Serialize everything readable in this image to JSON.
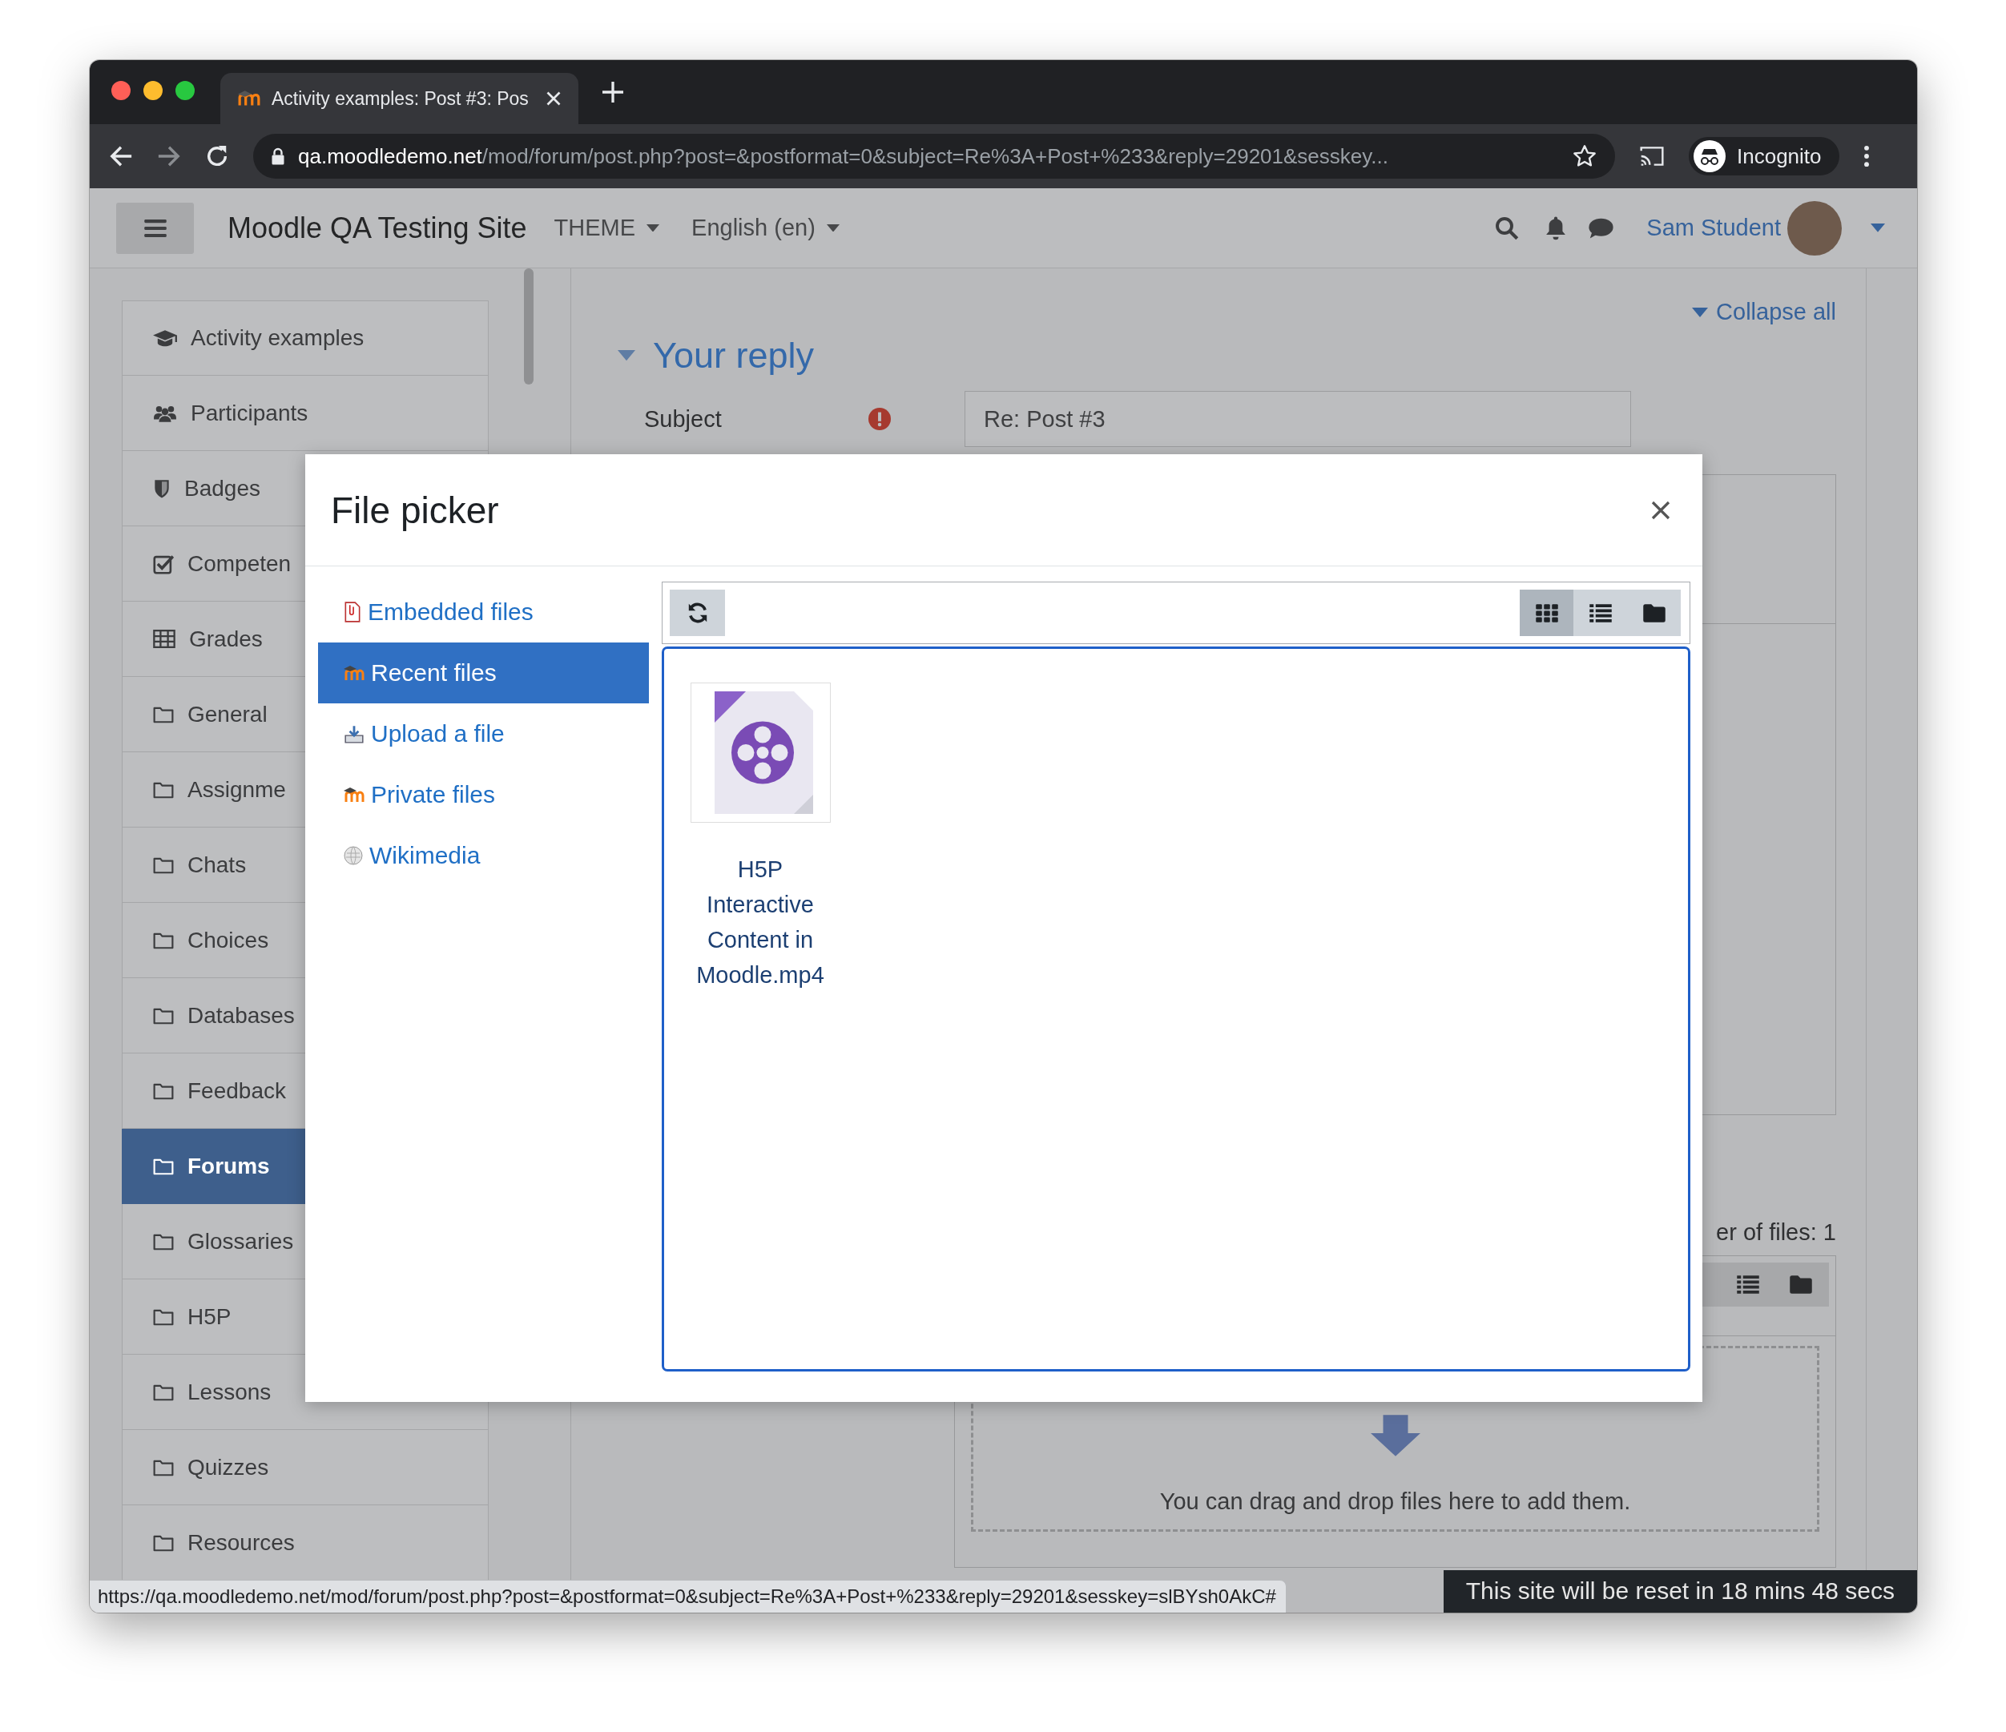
{
  "browser": {
    "tab_title": "Activity examples: Post #3: Pos",
    "url_host": "qa.moodledemo.net",
    "url_path": "/mod/forum/post.php?post=&postformat=0&subject=Re%3A+Post+%233&reply=29201&sesskey...",
    "profile": "Incognito"
  },
  "navbar": {
    "site_name": "Moodle QA Testing Site",
    "menus": [
      "THEME",
      "English (en)"
    ],
    "user_name": "Sam Student"
  },
  "sidebar": {
    "items": [
      {
        "label": "Activity examples",
        "kind": "course",
        "selected": false
      },
      {
        "label": "Participants",
        "kind": "users",
        "selected": false
      },
      {
        "label": "Badges",
        "kind": "badge",
        "selected": false
      },
      {
        "label": "Competen",
        "kind": "competency",
        "selected": false
      },
      {
        "label": "Grades",
        "kind": "grades",
        "selected": false
      },
      {
        "label": "General",
        "kind": "folder",
        "selected": false
      },
      {
        "label": "Assignme",
        "kind": "folder",
        "selected": false
      },
      {
        "label": "Chats",
        "kind": "folder",
        "selected": false
      },
      {
        "label": "Choices",
        "kind": "folder",
        "selected": false
      },
      {
        "label": "Databases",
        "kind": "folder",
        "selected": false
      },
      {
        "label": "Feedback",
        "kind": "folder",
        "selected": false
      },
      {
        "label": "Forums",
        "kind": "folder",
        "selected": true
      },
      {
        "label": "Glossaries",
        "kind": "folder",
        "selected": false
      },
      {
        "label": "H5P",
        "kind": "folder",
        "selected": false
      },
      {
        "label": "Lessons",
        "kind": "folder",
        "selected": false
      },
      {
        "label": "Quizzes",
        "kind": "folder",
        "selected": false
      },
      {
        "label": "Resources",
        "kind": "folder",
        "selected": false
      }
    ]
  },
  "form": {
    "collapse_link": "Collapse all",
    "section_title": "Your reply",
    "subject_label": "Subject",
    "subject_value": "Re: Post #3",
    "file_count": "er of files: 1",
    "dropzone_text": "You can drag and drop files here to add them."
  },
  "file_picker": {
    "title": "File picker",
    "repositories": [
      {
        "label": "Embedded files",
        "kind": "embedded",
        "selected": false
      },
      {
        "label": "Recent files",
        "kind": "moodle",
        "selected": true
      },
      {
        "label": "Upload a file",
        "kind": "upload",
        "selected": false
      },
      {
        "label": "Private files",
        "kind": "moodle",
        "selected": false
      },
      {
        "label": "Wikimedia",
        "kind": "wikimedia",
        "selected": false
      }
    ],
    "view_modes": [
      {
        "kind": "icons",
        "selected": true
      },
      {
        "kind": "list",
        "selected": false
      },
      {
        "kind": "tree",
        "selected": false
      }
    ],
    "files": [
      {
        "name": "H5P Interactive Content in Moodle.mp4"
      }
    ]
  },
  "status_link": "https://qa.moodledemo.net/mod/forum/post.php?post=&postformat=0&subject=Re%3A+Post+%233&reply=29201&sesskey=slBYsh0AkC#",
  "reset_notice": "This site will be reset in 18 mins 48 secs"
}
